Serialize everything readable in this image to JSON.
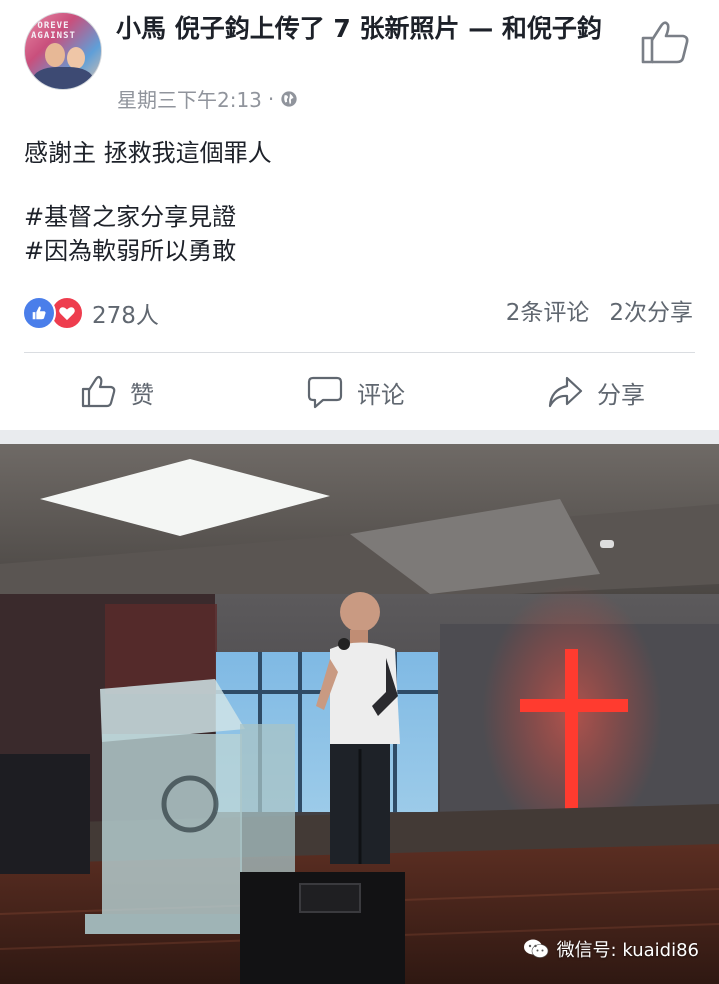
{
  "post": {
    "author_line": "小馬 倪子鈞上传了 7 张新照片 — 和倪子鈞",
    "timestamp": "星期三下午2:13",
    "separator": "·",
    "privacy_icon": "globe-icon",
    "avatar_text": "FOREVE AGAINST",
    "body_lines": [
      "感謝主 拯救我這個罪人",
      "#基督之家分享見證",
      "#因為軟弱所以勇敢"
    ]
  },
  "reactions": {
    "icons": [
      "like-icon",
      "love-icon"
    ],
    "count": "278人",
    "comments": "2条评论",
    "shares": "2次分享",
    "like_color": "#4a7eea",
    "love_color": "#ee3d4e"
  },
  "actions": {
    "like_label": "赞",
    "comment_label": "评论",
    "share_label": "分享"
  },
  "watermark": {
    "text": "微信号: kuaidi86",
    "icon": "wechat-icon"
  },
  "colors": {
    "text_primary": "#1d2129",
    "text_secondary": "#606770",
    "meta": "#90949c",
    "cross_glow": "#ff3b2f"
  }
}
